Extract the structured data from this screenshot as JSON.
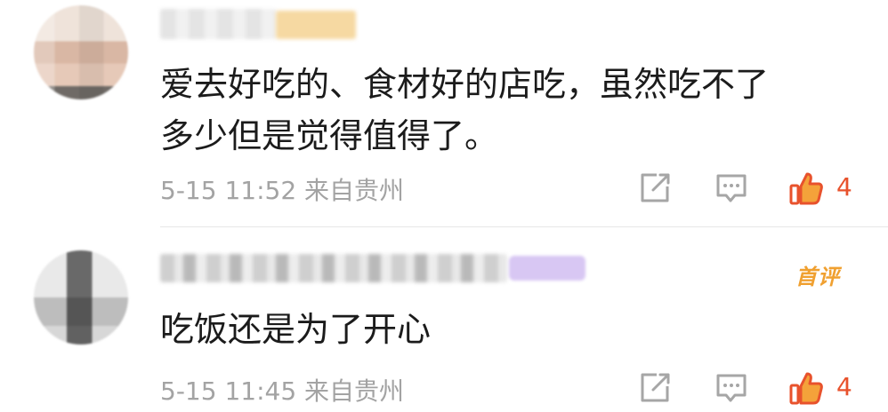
{
  "comments": [
    {
      "text_line1": "爱去好吃的、食材好的店吃，虽然吃不了",
      "text_line2": "多少但是觉得值得了。",
      "time": "5-15 11:52",
      "location": "来自贵州",
      "likes": "4"
    },
    {
      "badge": "首评",
      "text_line1": "吃饭还是为了开心",
      "time": "5-15 11:45",
      "location": "来自贵州",
      "likes": "4"
    }
  ],
  "icons": [
    "share-icon",
    "comment-icon",
    "like-icon"
  ],
  "colors": {
    "like_orange": "#e8522c",
    "first_badge": "#f0a030",
    "meta_gray": "#a3a3a3"
  }
}
